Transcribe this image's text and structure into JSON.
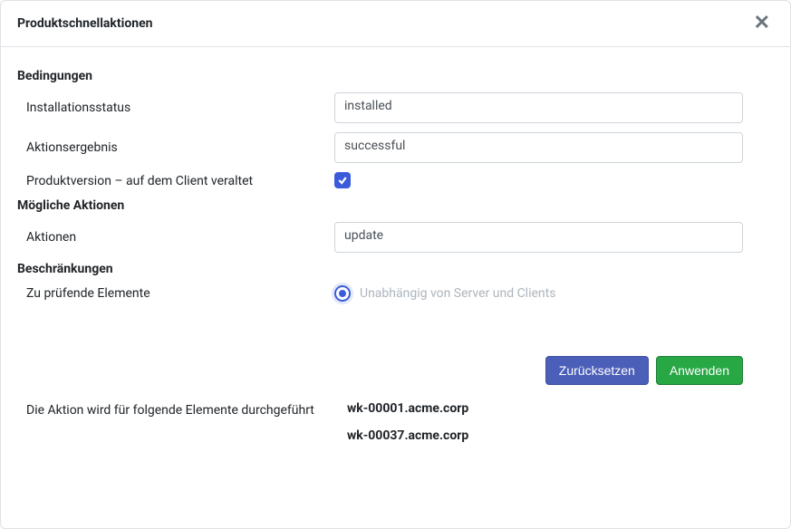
{
  "dialog": {
    "title": "Produktschnellaktionen"
  },
  "sections": {
    "conditions": {
      "header": "Bedingungen",
      "install_status_label": "Installationsstatus",
      "install_status_value": "installed",
      "action_result_label": "Aktionsergebnis",
      "action_result_value": "successful",
      "outdated_label": "Produktversion – auf dem Client veraltet"
    },
    "actions": {
      "header": "Mögliche Aktionen",
      "actions_label": "Aktionen",
      "actions_value": "update"
    },
    "restrictions": {
      "header": "Beschränkungen",
      "check_items_label": "Zu prüfende Elemente",
      "radio_text": "Unabhängig von Server und Clients"
    }
  },
  "buttons": {
    "reset": "Zurücksetzen",
    "apply": "Anwenden"
  },
  "targets": {
    "label": "Die Aktion wird für folgende Elemente durchgeführt",
    "items": [
      "wk-00001.acme.corp",
      "wk-00037.acme.corp"
    ]
  }
}
